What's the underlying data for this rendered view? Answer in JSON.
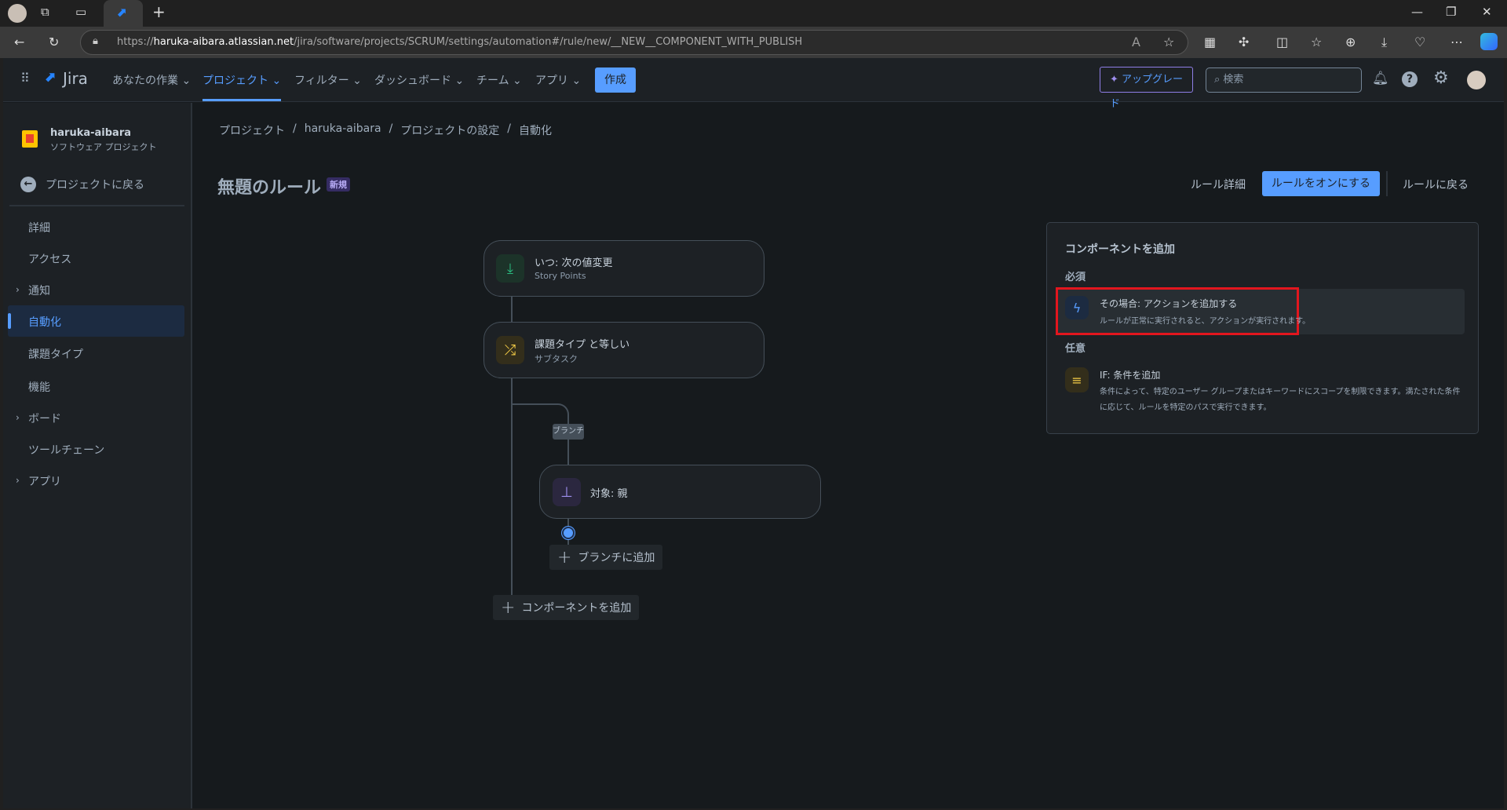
{
  "browser": {
    "url_host": "haruka-aibara.atlassian.net",
    "url_path": "/jira/software/projects/SCRUM/settings/automation#/rule/new/__NEW__COMPONENT_WITH_PUBLISH"
  },
  "topnav": {
    "logo": "Jira",
    "items": [
      "あなたの作業",
      "プロジェクト",
      "フィルター",
      "ダッシュボード",
      "チーム",
      "アプリ"
    ],
    "create": "作成",
    "upgrade": "アップグレード",
    "search_placeholder": "検索"
  },
  "sidebar": {
    "project_name": "haruka-aibara",
    "project_type": "ソフトウェア プロジェクト",
    "back": "プロジェクトに戻る",
    "items": [
      "詳細",
      "アクセス",
      "通知",
      "自動化",
      "課題タイプ",
      "機能",
      "ボード",
      "ツールチェーン",
      "アプリ"
    ],
    "active": "自動化"
  },
  "breadcrumb": [
    "プロジェクト",
    "haruka-aibara",
    "プロジェクトの設定",
    "自動化"
  ],
  "header": {
    "title": "無題のルール",
    "badge": "新規",
    "rule_details": "ルール詳細",
    "enable": "ルールをオンにする",
    "back": "ルールに戻る"
  },
  "flow": {
    "trigger": {
      "title": "いつ: 次の値変更",
      "sub": "Story Points"
    },
    "condition": {
      "title": "課題タイプ と等しい",
      "sub": "サブタスク"
    },
    "branch_label": "ブランチ",
    "branch": {
      "title": "対象: 親"
    },
    "add_to_branch": "ブランチに追加",
    "add_component": "コンポーネントを追加"
  },
  "panel": {
    "title": "コンポーネントを追加",
    "required": "必須",
    "action": {
      "title": "その場合: アクションを追加する",
      "desc": "ルールが正常に実行されると、アクションが実行されます。"
    },
    "optional": "任意",
    "condition": {
      "title": "IF: 条件を追加",
      "desc": "条件によって、特定のユーザー グループまたはキーワードにスコープを制限できます。満たされた条件に応じて、ルールを特定のパスで実行できます。"
    }
  },
  "colors": {
    "accent": "#579dff",
    "highlight": "#e2161e"
  }
}
